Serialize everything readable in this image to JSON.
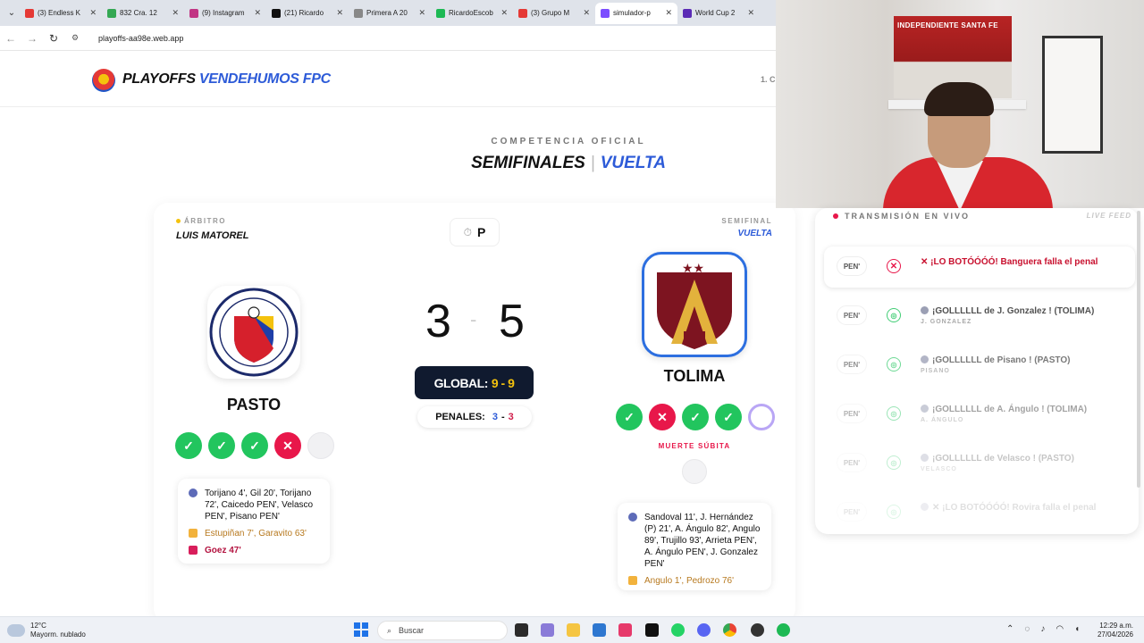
{
  "browser": {
    "tabs": [
      {
        "label": "(3) Endless K",
        "color": "#e53935"
      },
      {
        "label": "832 Cra. 12",
        "color": "#34a853"
      },
      {
        "label": "(9) Instagram",
        "color": "#c13584"
      },
      {
        "label": "(21) Ricardo",
        "color": "#111111"
      },
      {
        "label": "Primera A 20",
        "color": "#888888"
      },
      {
        "label": "RicardoEscob",
        "color": "#1db954"
      },
      {
        "label": "(3) Grupo M",
        "color": "#e53935"
      },
      {
        "label": "simulador-p",
        "color": "#7c4dff"
      },
      {
        "label": "World Cup 2",
        "color": "#5b2bb5"
      }
    ],
    "url": "playoffs-aa98e.web.app"
  },
  "site": {
    "brand_1": "PLAYOFFS",
    "brand_2": "VENDEHUMOS FPC",
    "header_clip": "1. C"
  },
  "stage": {
    "kicker": "COMPETENCIA OFICIAL",
    "round": "SEMIFINALES",
    "sep": "|",
    "leg": "VUELTA"
  },
  "match": {
    "referee_cap": "ÁRBITRO",
    "referee": "LUIS MATOREL",
    "timer": "P",
    "stage_cap": "SEMIFINAL",
    "stage_leg": "VUELTA",
    "home": {
      "name": "PASTO",
      "score": "3"
    },
    "away": {
      "name": "TOLIMA",
      "score": "5"
    },
    "score_sep": "-",
    "global_label": "GLOBAL:",
    "global_value": "9 - 9",
    "pens_label": "PENALES:",
    "pens_home": "3",
    "pens_sep": "-",
    "pens_away": "3",
    "home_kicks": [
      "ok",
      "ok",
      "ok",
      "miss",
      "pending"
    ],
    "away_kicks": [
      "ok",
      "miss",
      "ok",
      "ok",
      "next"
    ],
    "kick_ok_glyph": "✓",
    "kick_miss_glyph": "✕",
    "sudden_death": "MUERTE SÚBITA",
    "home_events": {
      "goals": "Torijano 4', Gil 20', Torijano 72', Caicedo PEN', Velasco PEN', Pisano PEN'",
      "yellow": "Estupiñan 7', Garavito 63'",
      "red": "Goez 47'"
    },
    "away_events": {
      "goals": "Sandoval 11', J. Hernández (P) 21', A. Ángulo 82', Angulo 89', Trujillo 93', Arrieta PEN', A. Ángulo PEN', J. Gonzalez PEN'",
      "yellow": "Angulo 1', Pedrozo 76'"
    }
  },
  "live": {
    "caption": "TRANSMISIÓN EN VIVO",
    "feed_label": "LIVE FEED",
    "items": [
      {
        "pen": "PEN'",
        "status": "✕",
        "kind": "x",
        "text": "✕ ¡LO BOTÓÓÓÓ! Banguera falla el penal",
        "sub": "",
        "opacity": 1
      },
      {
        "pen": "PEN'",
        "status": "◎",
        "kind": "g",
        "text": "¡GOLLLLLL de J. Gonzalez ! (TOLIMA)",
        "sub": "J. GONZALEZ",
        "opacity": 0.85
      },
      {
        "pen": "PEN'",
        "status": "◎",
        "kind": "g",
        "text": "¡GOLLLLLL de Pisano ! (PASTO)",
        "sub": "PISANO",
        "opacity": 0.65
      },
      {
        "pen": "PEN'",
        "status": "◎",
        "kind": "g",
        "text": "¡GOLLLLLL de A. Ángulo ! (TOLIMA)",
        "sub": "A. ÁNGULO",
        "opacity": 0.45
      },
      {
        "pen": "PEN'",
        "status": "◎",
        "kind": "g",
        "text": "¡GOLLLLLL de Velasco ! (PASTO)",
        "sub": "VELASCO",
        "opacity": 0.28
      },
      {
        "pen": "PEN'",
        "status": "◎",
        "kind": "g",
        "text": "✕ ¡LO BOTÓÓÓÓ! Rovira falla el penal",
        "sub": "",
        "opacity": 0.15
      }
    ]
  },
  "webcam": {
    "poster_text": "INDEPENDIENTE SANTA FE"
  },
  "taskbar": {
    "temp": "12°C",
    "weather": "Mayorm. nublado",
    "search": "Buscar",
    "time": "12:29 a.m.",
    "date": "27/04/2026"
  }
}
